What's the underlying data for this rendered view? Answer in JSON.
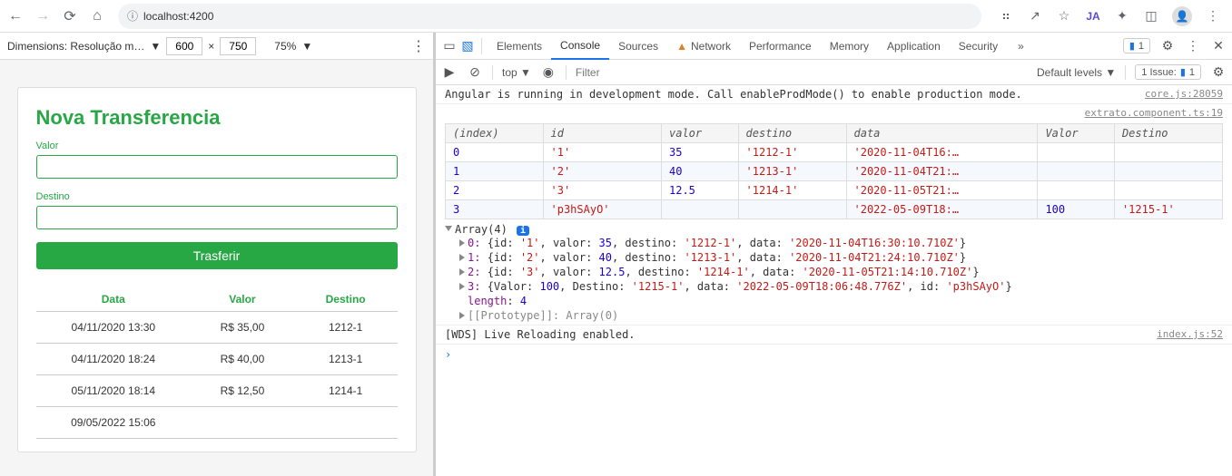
{
  "browser": {
    "url": "localhost:4200"
  },
  "device_bar": {
    "label": "Dimensions: Resolução m…",
    "width": "600",
    "height": "750",
    "zoom": "75%"
  },
  "app": {
    "title": "Nova Transferencia",
    "valor_label": "Valor",
    "destino_label": "Destino",
    "button_label": "Trasferir",
    "table_headers": {
      "data": "Data",
      "valor": "Valor",
      "destino": "Destino"
    },
    "rows": [
      {
        "data": "04/11/2020 13:30",
        "valor": "R$ 35,00",
        "destino": "1212-1"
      },
      {
        "data": "04/11/2020 18:24",
        "valor": "R$ 40,00",
        "destino": "1213-1"
      },
      {
        "data": "05/11/2020 18:14",
        "valor": "R$ 12,50",
        "destino": "1214-1"
      },
      {
        "data": "09/05/2022 15:06",
        "valor": "",
        "destino": ""
      }
    ]
  },
  "devtools": {
    "tabs": [
      "Elements",
      "Console",
      "Sources",
      "Network",
      "Performance",
      "Memory",
      "Application",
      "Security"
    ],
    "active_tab": "Console",
    "chip_count": "1",
    "filter_placeholder": "Filter",
    "top_label": "top",
    "default_levels": "Default levels",
    "issues_label": "1 Issue:",
    "issues_count": "1"
  },
  "console": {
    "angular_msg": "Angular is running in development mode. Call enableProdMode() to enable production mode.",
    "angular_src": "core.js:28059",
    "extrato_src": "extrato.component.ts:19",
    "table_headers": [
      "(index)",
      "id",
      "valor",
      "destino",
      "data",
      "Valor",
      "Destino"
    ],
    "table_rows": [
      {
        "index": "0",
        "id": "'1'",
        "valor": "35",
        "destino": "'1212-1'",
        "data": "'2020-11-04T16:…",
        "Valor": "",
        "Destino": ""
      },
      {
        "index": "1",
        "id": "'2'",
        "valor": "40",
        "destino": "'1213-1'",
        "data": "'2020-11-04T21:…",
        "Valor": "",
        "Destino": ""
      },
      {
        "index": "2",
        "id": "'3'",
        "valor": "12.5",
        "destino": "'1214-1'",
        "data": "'2020-11-05T21:…",
        "Valor": "",
        "Destino": ""
      },
      {
        "index": "3",
        "id": "'p3hSAyO'",
        "valor": "",
        "destino": "",
        "data": "'2022-05-09T18:…",
        "Valor": "100",
        "Destino": "'1215-1'"
      }
    ],
    "array_head": "Array(4)",
    "array_items": [
      "0: {id: '1', valor: 35, destino: '1212-1', data: '2020-11-04T16:30:10.710Z'}",
      "1: {id: '2', valor: 40, destino: '1213-1', data: '2020-11-04T21:24:10.710Z'}",
      "2: {id: '3', valor: 12.5, destino: '1214-1', data: '2020-11-05T21:14:10.710Z'}",
      "3: {Valor: 100, Destino: '1215-1', data: '2022-05-09T18:06:48.776Z', id: 'p3hSAyO'}"
    ],
    "length_label": "length",
    "length_val": "4",
    "proto_label": "[[Prototype]]: Array(0)",
    "wds_msg": "[WDS] Live Reloading enabled.",
    "wds_src": "index.js:52"
  }
}
